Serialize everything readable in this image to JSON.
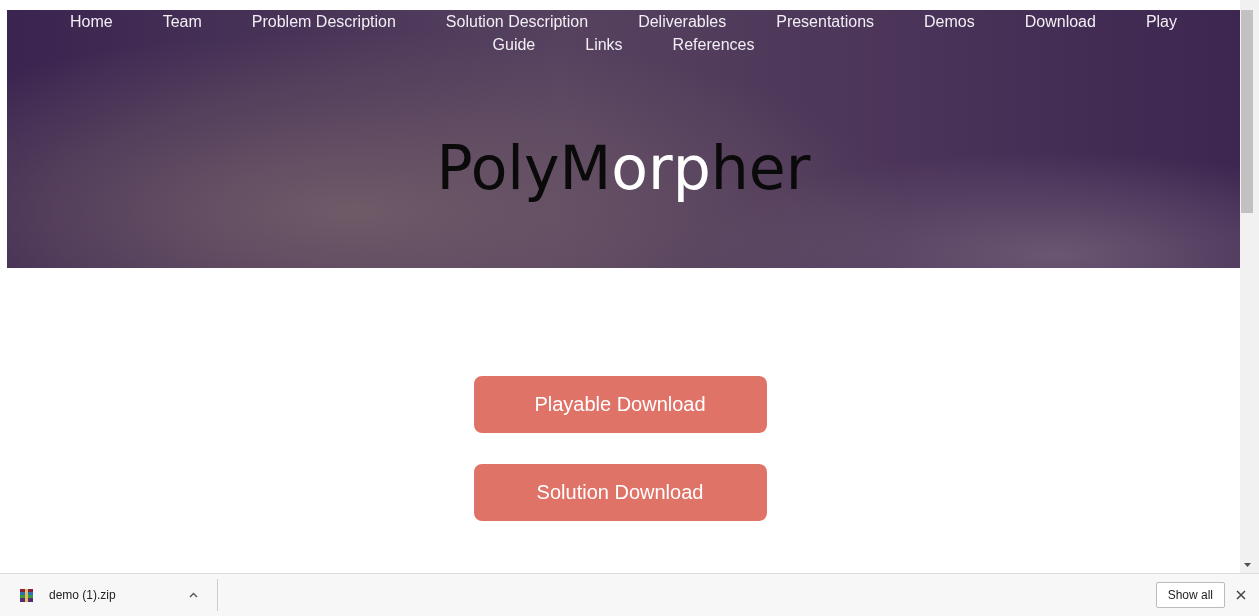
{
  "nav": {
    "items": [
      {
        "label": "Home"
      },
      {
        "label": "Team"
      },
      {
        "label": "Problem Description"
      },
      {
        "label": "Solution Description"
      },
      {
        "label": "Deliverables"
      },
      {
        "label": "Presentations"
      },
      {
        "label": "Demos"
      },
      {
        "label": "Download"
      },
      {
        "label": "Play"
      },
      {
        "label": "Guide"
      },
      {
        "label": "Links"
      },
      {
        "label": "References"
      }
    ]
  },
  "title": {
    "segments": [
      {
        "text": "PolyM",
        "color": "#0a0a0a"
      },
      {
        "text": "orp",
        "color": "#ffffff"
      },
      {
        "text": "her",
        "color": "#0a0a0a"
      }
    ]
  },
  "buttons": [
    {
      "label": "Playable Download"
    },
    {
      "label": "Solution Download"
    }
  ],
  "download_shelf": {
    "file": "demo (1).zip",
    "show_all": "Show all"
  }
}
